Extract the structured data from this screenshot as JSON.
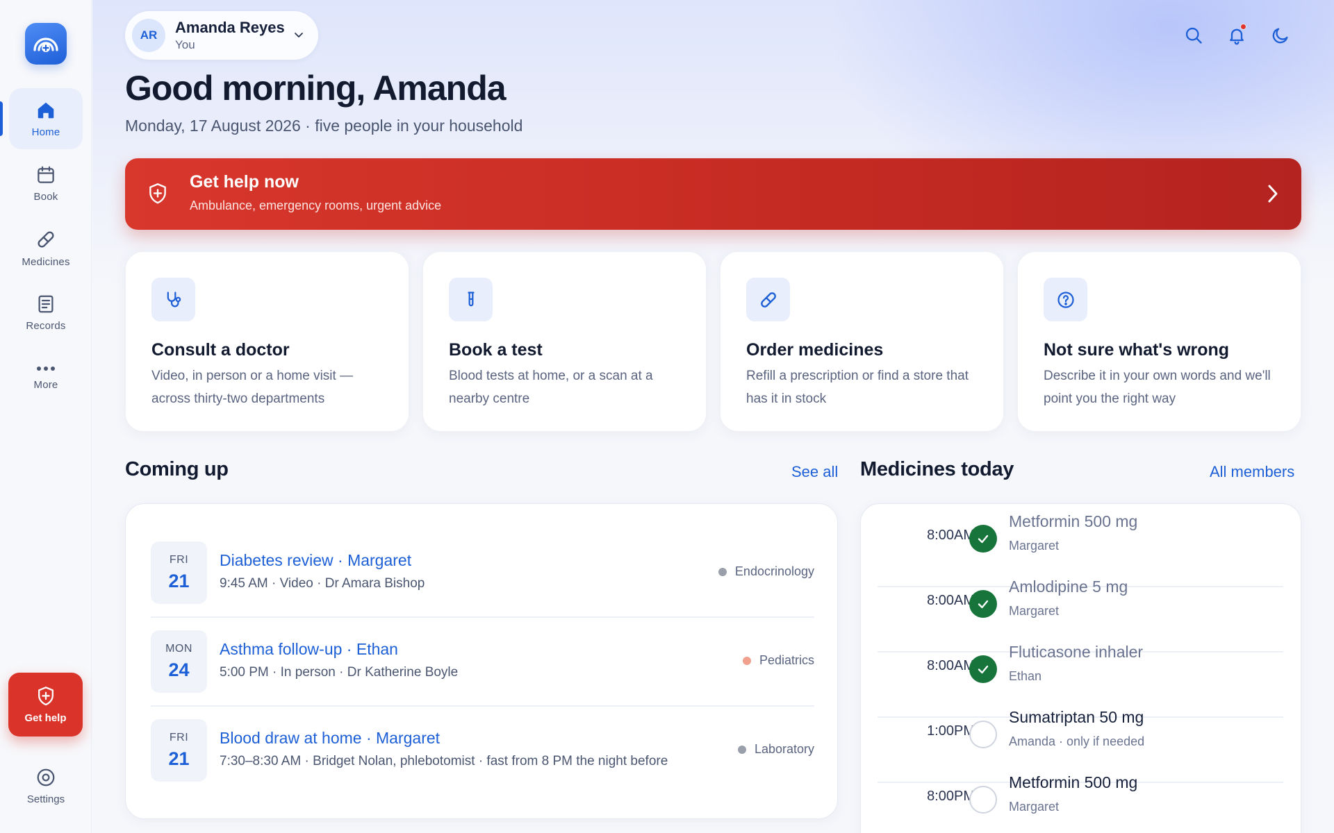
{
  "sidebar": {
    "items": [
      {
        "label": "Home",
        "icon": "home-icon"
      },
      {
        "label": "Book",
        "icon": "calendar-icon"
      },
      {
        "label": "Medicines",
        "icon": "pill-icon"
      },
      {
        "label": "Records",
        "icon": "document-icon"
      },
      {
        "label": "More",
        "icon": "more-icon"
      }
    ],
    "get_help_label": "Get help",
    "settings_label": "Settings"
  },
  "header": {
    "avatar_initials": "AR",
    "user_name": "Amanda Reyes",
    "user_sub": "You",
    "greeting": "Good morning, Amanda",
    "subline": "Monday, 17 August 2026 · five people in your household"
  },
  "emergency": {
    "title": "Get help now",
    "desc": "Ambulance, emergency rooms, urgent advice"
  },
  "cards": [
    {
      "title": "Consult a doctor",
      "desc": "Video, in person or a home visit — across thirty-two departments",
      "icon": "stethoscope-icon"
    },
    {
      "title": "Book a test",
      "desc": "Blood tests at home, or a scan at a nearby centre",
      "icon": "test-tube-icon"
    },
    {
      "title": "Order medicines",
      "desc": "Refill a prescription or find a store that has it in stock",
      "icon": "pill-icon"
    },
    {
      "title": "Not sure what's wrong",
      "desc": "Describe it in your own words and we'll point you the right way",
      "icon": "question-icon"
    }
  ],
  "coming_up": {
    "title": "Coming up",
    "link": "See all",
    "items": [
      {
        "dow": "FRI",
        "day": "21",
        "title": "Diabetes review · Margaret",
        "detail": "9:45 AM · Video · Dr Amara Bishop",
        "dept": "Endocrinology",
        "dot_color": "#9aa0ab"
      },
      {
        "dow": "MON",
        "day": "24",
        "title": "Asthma follow-up · Ethan",
        "detail": "5:00 PM · In person · Dr Katherine Boyle",
        "dept": "Pediatrics",
        "dot_color": "#f0a08c"
      },
      {
        "dow": "FRI",
        "day": "21",
        "title": "Blood draw at home · Margaret",
        "detail": "7:30–8:30 AM · Bridget Nolan, phlebotomist · fast from 8 PM the night before",
        "dept": "Laboratory",
        "dot_color": "#9aa0ab"
      }
    ]
  },
  "medicines": {
    "title": "Medicines today",
    "link": "All members",
    "items": [
      {
        "time": "8:00AM",
        "name": "Metformin 500 mg",
        "person": "Margaret",
        "taken": true
      },
      {
        "time": "8:00AM",
        "name": "Amlodipine 5 mg",
        "person": "Margaret",
        "taken": true
      },
      {
        "time": "8:00AM",
        "name": "Fluticasone inhaler",
        "person": "Ethan",
        "taken": true
      },
      {
        "time": "1:00PM",
        "name": "Sumatriptan 50 mg",
        "person": "Amanda · only if needed",
        "taken": false
      },
      {
        "time": "8:00PM",
        "name": "Metformin 500 mg",
        "person": "Margaret",
        "taken": false
      }
    ]
  },
  "colors": {
    "accent": "#1d5fd6",
    "emergency": "#d9332a",
    "taken": "#17743b"
  }
}
